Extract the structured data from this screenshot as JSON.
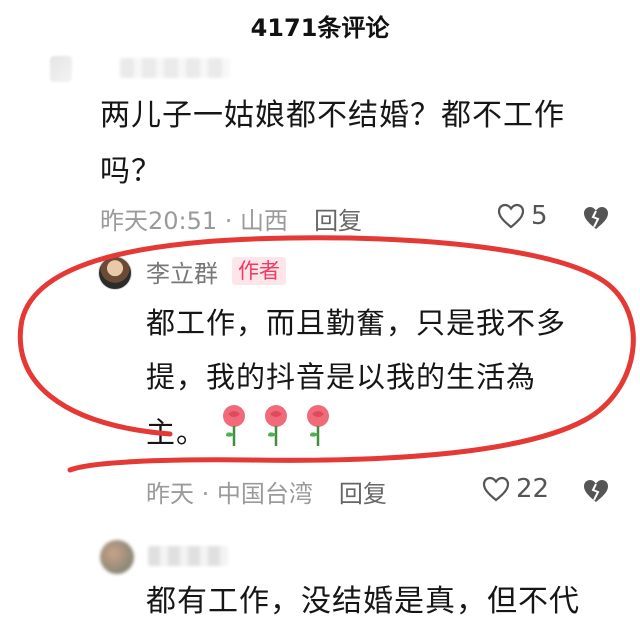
{
  "header": {
    "title": "4171条评论"
  },
  "comments": [
    {
      "text_line1": "两儿子一姑娘都不结婚？都不工作",
      "text_line2": "吗？",
      "time": "昨天20:51 · 山西",
      "reply_label": "回复",
      "likes": "5"
    }
  ],
  "reply": {
    "name": "李立群",
    "badge": "作者",
    "text_line1": "都工作，而且勤奮，只是我不多",
    "text_line2": "提，我的抖音是以我的生活為",
    "text_line3": "主。",
    "time": "昨天 · 中国台湾",
    "reply_label": "回复",
    "likes": "22"
  },
  "third": {
    "text_line1": "都有工作，没结婚是真，但不代"
  },
  "colors": {
    "accent": "#f03a63",
    "annotation": "#e53935",
    "meta": "#9a9a9a"
  },
  "icons": [
    "heart-outline-icon",
    "dislike-broken-heart-icon",
    "rose-emoji-icon"
  ]
}
